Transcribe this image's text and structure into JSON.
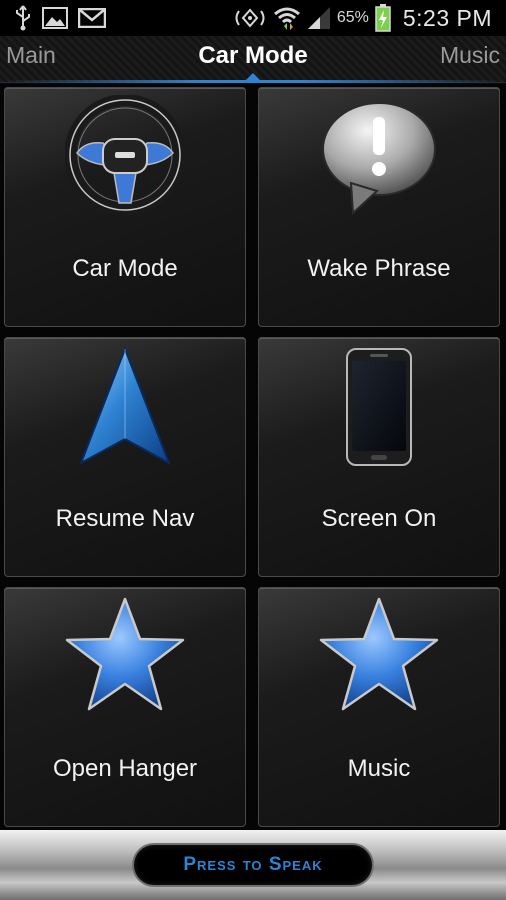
{
  "status_bar": {
    "left_icons": [
      "usb-icon",
      "image-icon",
      "gmail-icon"
    ],
    "right_icons": [
      "nfc-icon",
      "wifi-icon",
      "signal-icon",
      "battery-charging-icon"
    ],
    "battery_percent": "65%",
    "time": "5:23 PM"
  },
  "tabs": {
    "left": "Main",
    "active": "Car Mode",
    "right": "Music"
  },
  "tiles": [
    {
      "label": "Car Mode",
      "icon": "steering-wheel-icon"
    },
    {
      "label": "Wake Phrase",
      "icon": "speech-bubble-exclamation-icon"
    },
    {
      "label": "Resume Nav",
      "icon": "navigation-arrow-icon"
    },
    {
      "label": "Screen On",
      "icon": "smartphone-icon"
    },
    {
      "label": "Open Hanger",
      "icon": "star-icon"
    },
    {
      "label": "Music",
      "icon": "star-icon"
    }
  ],
  "bottom": {
    "speak_label": "Press to Speak"
  },
  "colors": {
    "accent": "#2f83d3",
    "background": "#0a0a0a",
    "tile_text": "#f2f2f2"
  }
}
